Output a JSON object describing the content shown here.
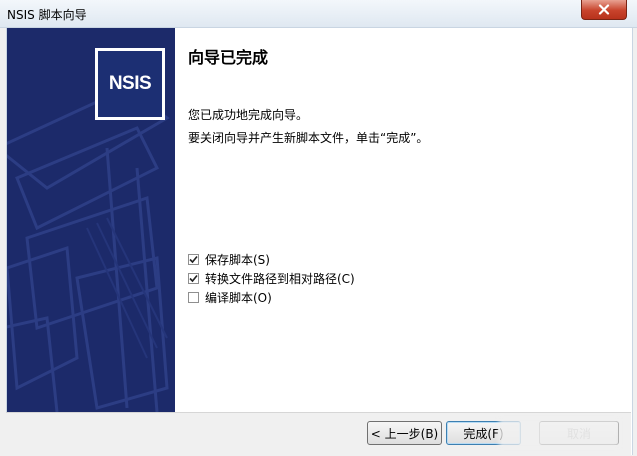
{
  "window": {
    "title": "NSIS 脚本向导",
    "close_icon": "close-icon"
  },
  "sidebar": {
    "logo_text": "NSIS",
    "background": "#1c2a6a"
  },
  "main": {
    "heading": "向导已完成",
    "line1": "您已成功地完成向导。",
    "line2": "要关闭向导并产生新脚本文件，单击“完成”。",
    "options": [
      {
        "label": "保存脚本(S)",
        "checked": true
      },
      {
        "label": "转换文件路径到相对路径(C)",
        "checked": true
      },
      {
        "label": "编译脚本(O)",
        "checked": false
      }
    ]
  },
  "footer": {
    "back_label": "< 上一步(B)",
    "finish_label": "完成(F)",
    "cancel_label": "取消"
  }
}
